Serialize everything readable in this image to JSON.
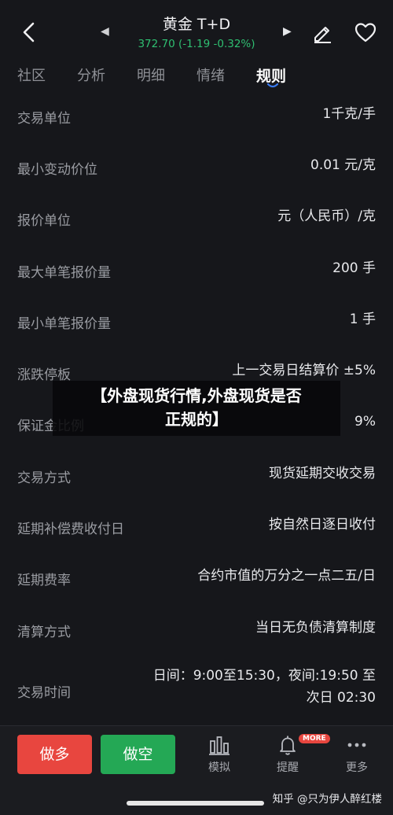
{
  "header": {
    "title": "黄金 T+D",
    "quote": "372.70 (-1.19 -0.32%)",
    "back_icon": "chevron-left-icon",
    "prev_icon": "triangle-left-icon",
    "next_icon": "triangle-right-icon",
    "edit_icon": "pencil-icon",
    "favorite_icon": "heart-icon",
    "quote_color": "#2fbf71"
  },
  "tabs": [
    {
      "label": "社区",
      "active": false
    },
    {
      "label": "分析",
      "active": false
    },
    {
      "label": "明细",
      "active": false
    },
    {
      "label": "情绪",
      "active": false
    },
    {
      "label": "规则",
      "active": true
    }
  ],
  "rules": [
    {
      "label": "交易单位",
      "value": "1千克/手"
    },
    {
      "label": "最小变动价位",
      "value": "0.01 元/克"
    },
    {
      "label": "报价单位",
      "value": "元（人民币）/克"
    },
    {
      "label": "最大单笔报价量",
      "value": "200 手"
    },
    {
      "label": "最小单笔报价量",
      "value": "1 手"
    },
    {
      "label": "涨跌停板",
      "value": "上一交易日结算价 ±5%"
    },
    {
      "label": "保证金比例",
      "value": "9%"
    },
    {
      "label": "交易方式",
      "value": "现货延期交收交易"
    },
    {
      "label": "延期补偿费收付日",
      "value": "按自然日逐日收付"
    },
    {
      "label": "延期费率",
      "value": "合约市值的万分之一点二五/日"
    },
    {
      "label": "清算方式",
      "value": "当日无负债清算制度"
    },
    {
      "label": "交易时间",
      "value_line1": "日间：9:00至15:30，夜间:19:50 至",
      "value_line2": "次日 02:30"
    }
  ],
  "banner": {
    "line1": "【外盘现货行情,外盘现货是否",
    "line2": "正规的】"
  },
  "bottom": {
    "buy_label": "做多",
    "sell_label": "做空",
    "tools": [
      {
        "label": "模拟",
        "icon": "bar-chart-icon"
      },
      {
        "label": "提醒",
        "icon": "bell-icon",
        "badge": "MORE"
      },
      {
        "label": "更多",
        "icon": "more-dots-icon"
      }
    ],
    "buy_color": "#e8463f",
    "sell_color": "#24a855"
  },
  "credit": "知乎 @只为伊人醉红楼"
}
